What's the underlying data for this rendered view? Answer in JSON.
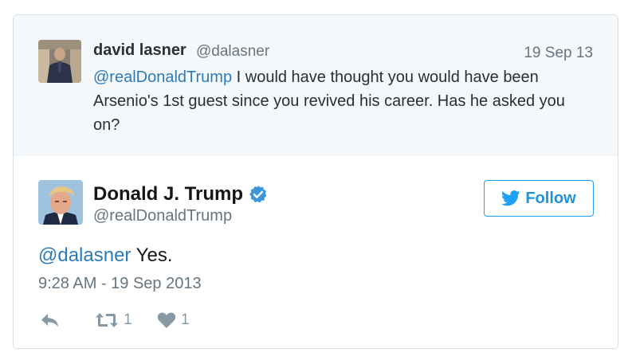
{
  "quoted_tweet": {
    "author_name": "david lasner",
    "author_handle": "@dalasner",
    "date": "19 Sep 13",
    "mention": "@realDonaldTrump",
    "text": " I would have thought you would have been Arsenio's 1st guest since you revived his career. Has he asked you on?"
  },
  "tweet": {
    "author_name": "Donald J. Trump",
    "author_handle": "@realDonaldTrump",
    "verified": true,
    "follow_label": "Follow",
    "mention": "@dalasner",
    "text": " Yes.",
    "timestamp": "9:28 AM - 19 Sep 2013",
    "retweet_count": "1",
    "like_count": "1"
  },
  "icons": {
    "reply": "reply-icon",
    "retweet": "retweet-icon",
    "like": "heart-icon",
    "verified": "verified-badge-icon",
    "follow": "twitter-bird-icon"
  },
  "colors": {
    "accent": "#1da1f2",
    "link": "#2b7bb9",
    "muted": "#66757f",
    "action": "#8899a6",
    "quote_bg": "#f5f8fa"
  }
}
